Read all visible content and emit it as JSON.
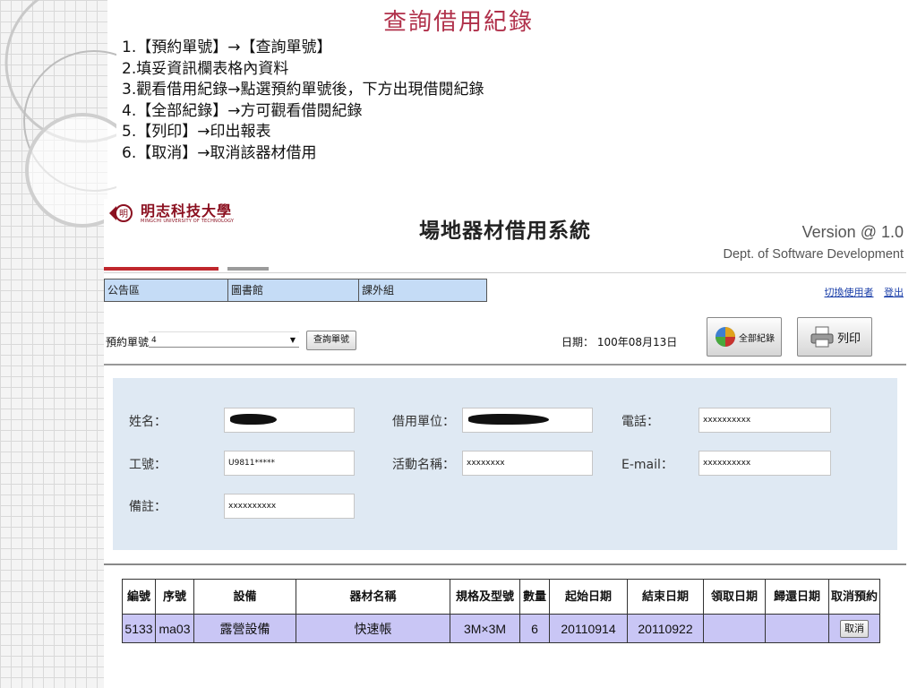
{
  "slide": {
    "title": "查詢借用紀錄",
    "steps": [
      "1.【預約單號】→【查詢單號】",
      "2.填妥資訊欄表格內資料",
      "3.觀看借用紀錄→點選預約單號後，下方出現借閱紀錄",
      "4.【全部紀錄】→方可觀看借閱紀錄",
      "5.【列印】→印出報表",
      "6.【取消】→取消該器材借用"
    ]
  },
  "header": {
    "logo_zh": "明志科技大學",
    "logo_en": "MINGCHI UNIVERSITY OF TECHNOLOGY",
    "system_title": "場地器材借用系統",
    "version": "Version @ 1.0",
    "dept": "Dept. of Software Development",
    "accent_color": "#c0272d"
  },
  "nav": {
    "items": [
      "公告區",
      "圖書館",
      "課外組"
    ],
    "switch_user": "切換使用者",
    "logout": "登出"
  },
  "filter": {
    "reservation_label": "預約單號",
    "reservation_value": "4",
    "query_button": "查詢單號",
    "date_label": "日期：",
    "date_value": "100年08月13日",
    "all_records_button": "全部紀錄",
    "print_button": "列印"
  },
  "form": {
    "name_label": "姓名：",
    "unit_label": "借用單位：",
    "phone_label": "電話：",
    "phone_value": "xxxxxxxxxx",
    "id_label": "工號：",
    "id_value": "U9811*****",
    "activity_label": "活動名稱：",
    "activity_value": "xxxxxxxx",
    "email_label": "E-mail：",
    "email_value": "xxxxxxxxxx",
    "note_label": "備註：",
    "note_value": "xxxxxxxxxx",
    "panel_color": "#dfe9f3"
  },
  "table": {
    "headers": [
      "編號",
      "序號",
      "設備",
      "器材名稱",
      "規格及型號",
      "數量",
      "起始日期",
      "結束日期",
      "領取日期",
      "歸還日期",
      "取消預約"
    ],
    "rows": [
      [
        "5133",
        "ma03",
        "露營設備",
        "快速帳",
        "3M×3M",
        "6",
        "20110914",
        "20110922",
        "",
        "",
        ""
      ]
    ],
    "cancel_button": "取消",
    "row_color": "#c9c6f5"
  }
}
